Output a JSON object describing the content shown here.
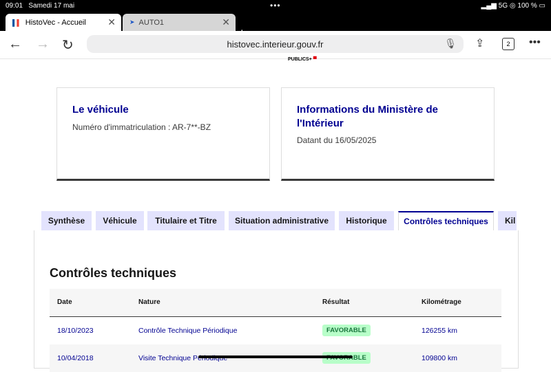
{
  "status_bar": {
    "time": "09:01",
    "date": "Samedi 17 mai",
    "network": "5G",
    "battery": "100 %"
  },
  "browser": {
    "tabs": [
      {
        "title": "HistoVec - Accueil",
        "active": true,
        "favicon": "french-flag-icon"
      },
      {
        "title": "AUTO1",
        "active": false,
        "favicon": "auto1-icon"
      }
    ],
    "url": "histovec.interieur.gouv.fr",
    "tab_count": "2"
  },
  "page": {
    "logo_text": "PUBLICS+",
    "card_vehicle": {
      "title": "Le véhicule",
      "text": "Numéro d'immatriculation : AR-7**-BZ"
    },
    "card_ministry": {
      "title_line1": "Informations du Ministère de",
      "title_line2": "l'Intérieur",
      "text": "Datant du 16/05/2025"
    },
    "tabs": [
      "Synthèse",
      "Véhicule",
      "Titulaire et Titre",
      "Situation administrative",
      "Historique",
      "Contrôles techniques",
      "Kil"
    ],
    "selected_tab": "Contrôles techniques",
    "section_title": "Contrôles techniques",
    "table": {
      "headers": [
        "Date",
        "Nature",
        "Résultat",
        "Kilométrage"
      ],
      "rows": [
        {
          "date": "18/10/2023",
          "nature": "Contrôle Technique Périodique",
          "result": "FAVORABLE",
          "km": "126255 km"
        },
        {
          "date": "10/04/2018",
          "nature": "Visite Technique Périodique",
          "result": "FAVORABLE",
          "km": "109800 km"
        }
      ]
    },
    "colors": {
      "primary": "#000091",
      "tab_bg": "#e3e3fd",
      "badge_bg": "#b8fec9",
      "badge_text": "#18753c"
    }
  }
}
